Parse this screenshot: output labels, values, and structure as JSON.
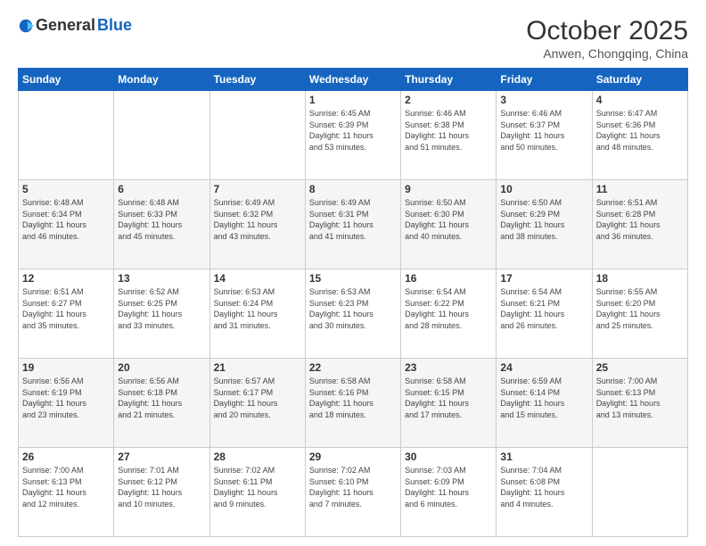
{
  "logo": {
    "general": "General",
    "blue": "Blue"
  },
  "header": {
    "month": "October 2025",
    "location": "Anwen, Chongqing, China"
  },
  "days_of_week": [
    "Sunday",
    "Monday",
    "Tuesday",
    "Wednesday",
    "Thursday",
    "Friday",
    "Saturday"
  ],
  "weeks": [
    [
      {
        "day": "",
        "info": ""
      },
      {
        "day": "",
        "info": ""
      },
      {
        "day": "",
        "info": ""
      },
      {
        "day": "1",
        "info": "Sunrise: 6:45 AM\nSunset: 6:39 PM\nDaylight: 11 hours\nand 53 minutes."
      },
      {
        "day": "2",
        "info": "Sunrise: 6:46 AM\nSunset: 6:38 PM\nDaylight: 11 hours\nand 51 minutes."
      },
      {
        "day": "3",
        "info": "Sunrise: 6:46 AM\nSunset: 6:37 PM\nDaylight: 11 hours\nand 50 minutes."
      },
      {
        "day": "4",
        "info": "Sunrise: 6:47 AM\nSunset: 6:36 PM\nDaylight: 11 hours\nand 48 minutes."
      }
    ],
    [
      {
        "day": "5",
        "info": "Sunrise: 6:48 AM\nSunset: 6:34 PM\nDaylight: 11 hours\nand 46 minutes."
      },
      {
        "day": "6",
        "info": "Sunrise: 6:48 AM\nSunset: 6:33 PM\nDaylight: 11 hours\nand 45 minutes."
      },
      {
        "day": "7",
        "info": "Sunrise: 6:49 AM\nSunset: 6:32 PM\nDaylight: 11 hours\nand 43 minutes."
      },
      {
        "day": "8",
        "info": "Sunrise: 6:49 AM\nSunset: 6:31 PM\nDaylight: 11 hours\nand 41 minutes."
      },
      {
        "day": "9",
        "info": "Sunrise: 6:50 AM\nSunset: 6:30 PM\nDaylight: 11 hours\nand 40 minutes."
      },
      {
        "day": "10",
        "info": "Sunrise: 6:50 AM\nSunset: 6:29 PM\nDaylight: 11 hours\nand 38 minutes."
      },
      {
        "day": "11",
        "info": "Sunrise: 6:51 AM\nSunset: 6:28 PM\nDaylight: 11 hours\nand 36 minutes."
      }
    ],
    [
      {
        "day": "12",
        "info": "Sunrise: 6:51 AM\nSunset: 6:27 PM\nDaylight: 11 hours\nand 35 minutes."
      },
      {
        "day": "13",
        "info": "Sunrise: 6:52 AM\nSunset: 6:25 PM\nDaylight: 11 hours\nand 33 minutes."
      },
      {
        "day": "14",
        "info": "Sunrise: 6:53 AM\nSunset: 6:24 PM\nDaylight: 11 hours\nand 31 minutes."
      },
      {
        "day": "15",
        "info": "Sunrise: 6:53 AM\nSunset: 6:23 PM\nDaylight: 11 hours\nand 30 minutes."
      },
      {
        "day": "16",
        "info": "Sunrise: 6:54 AM\nSunset: 6:22 PM\nDaylight: 11 hours\nand 28 minutes."
      },
      {
        "day": "17",
        "info": "Sunrise: 6:54 AM\nSunset: 6:21 PM\nDaylight: 11 hours\nand 26 minutes."
      },
      {
        "day": "18",
        "info": "Sunrise: 6:55 AM\nSunset: 6:20 PM\nDaylight: 11 hours\nand 25 minutes."
      }
    ],
    [
      {
        "day": "19",
        "info": "Sunrise: 6:56 AM\nSunset: 6:19 PM\nDaylight: 11 hours\nand 23 minutes."
      },
      {
        "day": "20",
        "info": "Sunrise: 6:56 AM\nSunset: 6:18 PM\nDaylight: 11 hours\nand 21 minutes."
      },
      {
        "day": "21",
        "info": "Sunrise: 6:57 AM\nSunset: 6:17 PM\nDaylight: 11 hours\nand 20 minutes."
      },
      {
        "day": "22",
        "info": "Sunrise: 6:58 AM\nSunset: 6:16 PM\nDaylight: 11 hours\nand 18 minutes."
      },
      {
        "day": "23",
        "info": "Sunrise: 6:58 AM\nSunset: 6:15 PM\nDaylight: 11 hours\nand 17 minutes."
      },
      {
        "day": "24",
        "info": "Sunrise: 6:59 AM\nSunset: 6:14 PM\nDaylight: 11 hours\nand 15 minutes."
      },
      {
        "day": "25",
        "info": "Sunrise: 7:00 AM\nSunset: 6:13 PM\nDaylight: 11 hours\nand 13 minutes."
      }
    ],
    [
      {
        "day": "26",
        "info": "Sunrise: 7:00 AM\nSunset: 6:13 PM\nDaylight: 11 hours\nand 12 minutes."
      },
      {
        "day": "27",
        "info": "Sunrise: 7:01 AM\nSunset: 6:12 PM\nDaylight: 11 hours\nand 10 minutes."
      },
      {
        "day": "28",
        "info": "Sunrise: 7:02 AM\nSunset: 6:11 PM\nDaylight: 11 hours\nand 9 minutes."
      },
      {
        "day": "29",
        "info": "Sunrise: 7:02 AM\nSunset: 6:10 PM\nDaylight: 11 hours\nand 7 minutes."
      },
      {
        "day": "30",
        "info": "Sunrise: 7:03 AM\nSunset: 6:09 PM\nDaylight: 11 hours\nand 6 minutes."
      },
      {
        "day": "31",
        "info": "Sunrise: 7:04 AM\nSunset: 6:08 PM\nDaylight: 11 hours\nand 4 minutes."
      },
      {
        "day": "",
        "info": ""
      }
    ]
  ]
}
